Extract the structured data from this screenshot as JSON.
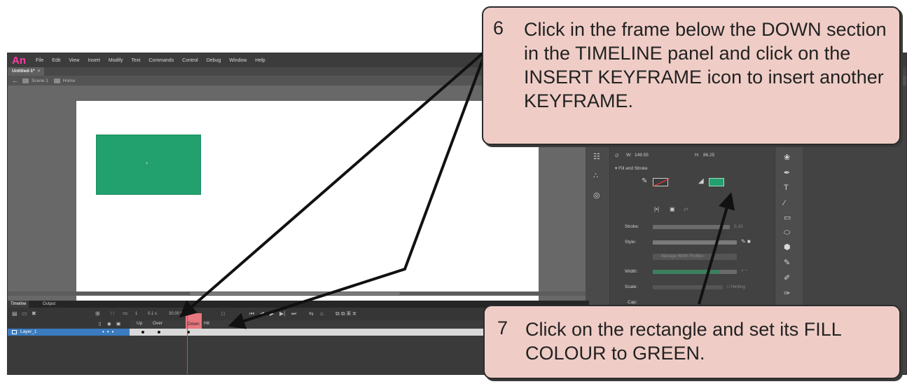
{
  "app": {
    "logo": "An",
    "menu": [
      "File",
      "Edit",
      "View",
      "Insert",
      "Modify",
      "Text",
      "Commands",
      "Control",
      "Debug",
      "Window",
      "Help"
    ],
    "document_tab": "Untitled-1*",
    "document_tab_close": "×",
    "breadcrumb": {
      "scene": "Scene 1",
      "symbol": "Home"
    }
  },
  "properties": {
    "w_label": "W:",
    "w_value": "149.55",
    "h_label": "H:",
    "h_value": "86.25",
    "section": "▾ Fill and Stroke",
    "stroke_label": "Stroke:",
    "stroke_value": "0.10",
    "style_label": "Style:",
    "manage_button": "Manage Width Profiles",
    "width_label": "Width:",
    "scale_label": "Scale:",
    "hinting_label": "Hinting",
    "cap_label": "Cap:",
    "fill_color": "#22a06e"
  },
  "timeline": {
    "tabs": [
      "Timeline",
      "Output"
    ],
    "fps": "30.00 fps",
    "time": "0.1 s",
    "frame_headers": [
      "Up",
      "Over",
      "Down",
      "Hit"
    ],
    "layer_name": "Layer_1"
  },
  "callouts": {
    "step6_number": "6",
    "step6_text": "Click in the frame below the DOWN section in the TIMELINE panel and click on the INSERT KEYFRAME icon to insert another KEYFRAME.",
    "step7_number": "7",
    "step7_text": "Click on the rectangle and set its FILL COLOUR to GREEN."
  }
}
